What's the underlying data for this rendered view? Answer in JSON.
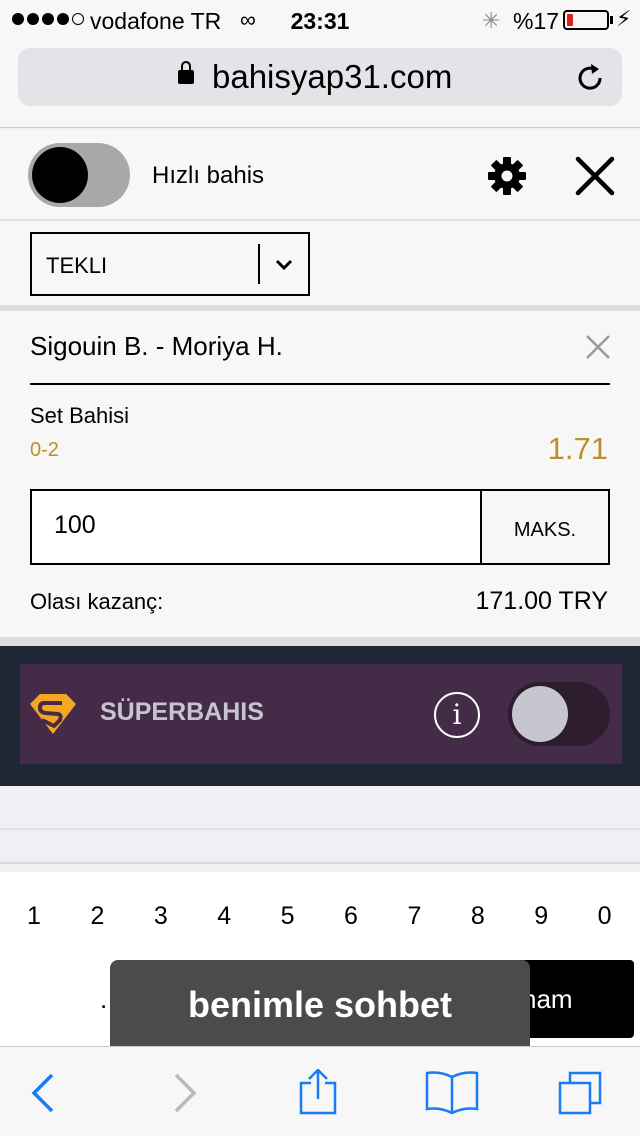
{
  "status_bar": {
    "carrier": "vodafone TR",
    "time": "23:31",
    "battery_percent_label": "%17",
    "battery_level": 0.17,
    "battery_color": "#e0201c"
  },
  "browser": {
    "url": "bahisyap31.com"
  },
  "betslip": {
    "quick_bet_label": "Hızlı bahis",
    "bet_type": "TEKLI",
    "selection": {
      "match": "Sigouin B. - Moriya H.",
      "market": "Set Bahisi",
      "pick": "0-2",
      "odds": "1.71"
    },
    "stake_value": "100",
    "max_label": "MAKS.",
    "potential_win_label": "Olası kazanç:",
    "potential_win_value": "171.00 TRY",
    "accent_color": "#b8902f"
  },
  "superbet": {
    "label": "SÜPERBAHIS",
    "info_glyph": "i"
  },
  "keyboard": {
    "digits": [
      "1",
      "2",
      "3",
      "4",
      "5",
      "6",
      "7",
      "8",
      "9",
      "0"
    ],
    "dot_label": ".",
    "done_label": "nam"
  },
  "chat": {
    "label": "benimle sohbet"
  },
  "icons": {
    "lock": "lock-icon",
    "reload": "reload-icon",
    "settings": "gear-icon",
    "close": "close-icon",
    "back": "back-arrow-icon",
    "forward": "forward-arrow-icon",
    "share": "share-icon",
    "bookmarks": "bookmarks-icon",
    "tabs": "tabs-icon"
  }
}
